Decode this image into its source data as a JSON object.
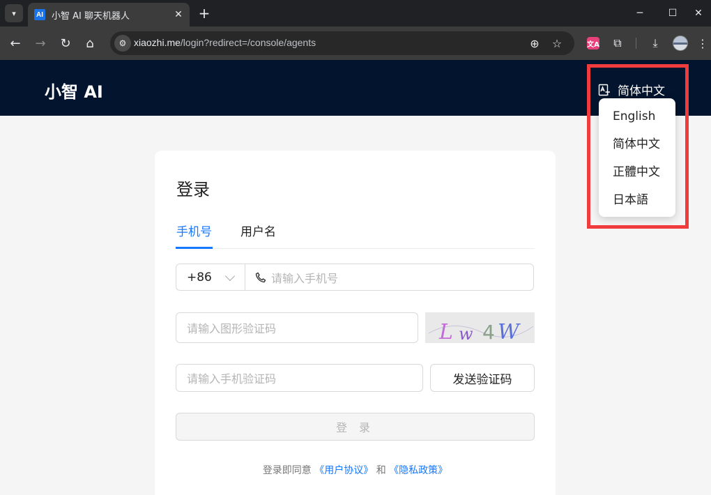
{
  "browser": {
    "tab_title": "小智 AI 聊天机器人",
    "favicon_text": "AI",
    "url_host": "xiaozhi.me",
    "url_path": "/login?redirect=/console/agents",
    "ext_translate_text": "文A"
  },
  "header": {
    "brand": "小智 AI",
    "current_language": "简体中文"
  },
  "language_menu": {
    "items": [
      "English",
      "简体中文",
      "正體中文",
      "日本語"
    ]
  },
  "login": {
    "title": "登录",
    "tabs": [
      "手机号",
      "用户名"
    ],
    "country_code": "+86",
    "phone_placeholder": "请输入手机号",
    "captcha_placeholder": "请输入图形验证码",
    "captcha_text": "Lw4W",
    "sms_placeholder": "请输入手机验证码",
    "send_code_label": "发送验证码",
    "login_label": "登 录",
    "agreement_prefix": "登录即同意",
    "user_agreement": "《用户协议》",
    "agreement_and": "和",
    "privacy_policy": "《隐私政策》"
  },
  "colors": {
    "header_bg": "#03142e",
    "accent": "#1677ff",
    "highlight": "#f03c3c"
  }
}
